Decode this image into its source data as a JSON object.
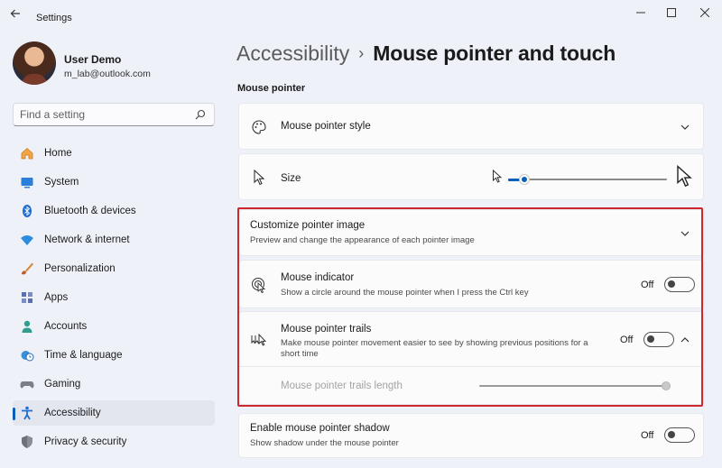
{
  "window": {
    "title": "Settings"
  },
  "profile": {
    "name": "User Demo",
    "email": "m_lab@outlook.com"
  },
  "search": {
    "placeholder": "Find a setting"
  },
  "nav": [
    {
      "label": "Home",
      "icon": "home-icon",
      "active": false
    },
    {
      "label": "System",
      "icon": "system-icon",
      "active": false
    },
    {
      "label": "Bluetooth & devices",
      "icon": "bluetooth-icon",
      "active": false
    },
    {
      "label": "Network & internet",
      "icon": "wifi-icon",
      "active": false
    },
    {
      "label": "Personalization",
      "icon": "brush-icon",
      "active": false
    },
    {
      "label": "Apps",
      "icon": "apps-icon",
      "active": false
    },
    {
      "label": "Accounts",
      "icon": "accounts-icon",
      "active": false
    },
    {
      "label": "Time & language",
      "icon": "clock-globe-icon",
      "active": false
    },
    {
      "label": "Gaming",
      "icon": "gamepad-icon",
      "active": false
    },
    {
      "label": "Accessibility",
      "icon": "accessibility-icon",
      "active": true
    },
    {
      "label": "Privacy & security",
      "icon": "shield-icon",
      "active": false
    }
  ],
  "breadcrumb": {
    "parent": "Accessibility",
    "separator": "›",
    "current": "Mouse pointer and touch"
  },
  "section": {
    "title": "Mouse pointer"
  },
  "settings": {
    "pointer_style": {
      "title": "Mouse pointer style",
      "icon": "palette-icon"
    },
    "size": {
      "title": "Size",
      "icon": "cursor-icon",
      "slider_level_percent": 8
    },
    "customize": {
      "title": "Customize pointer image",
      "subtitle": "Preview and change the appearance of each pointer image"
    },
    "indicator": {
      "title": "Mouse indicator",
      "subtitle": "Show a circle around the mouse pointer when I press the Ctrl key",
      "state": "Off",
      "icon": "pointer-indicator-icon"
    },
    "trails": {
      "title": "Mouse pointer trails",
      "subtitle_line1": "Make mouse pointer movement easier to see by showing previous positions for a",
      "subtitle_line2": "short time",
      "state": "Off",
      "icon": "pointer-trails-icon"
    },
    "trails_length": {
      "label": "Mouse pointer trails length",
      "disabled": true,
      "slider_level_percent": 100
    },
    "shadow": {
      "title": "Enable mouse pointer shadow",
      "subtitle": "Show shadow under the mouse pointer",
      "state": "Off"
    }
  },
  "colors": {
    "accent": "#0a5fb8",
    "highlight_border": "#d0262e",
    "background": "#eef1f8",
    "card": "#fbfbfc"
  }
}
